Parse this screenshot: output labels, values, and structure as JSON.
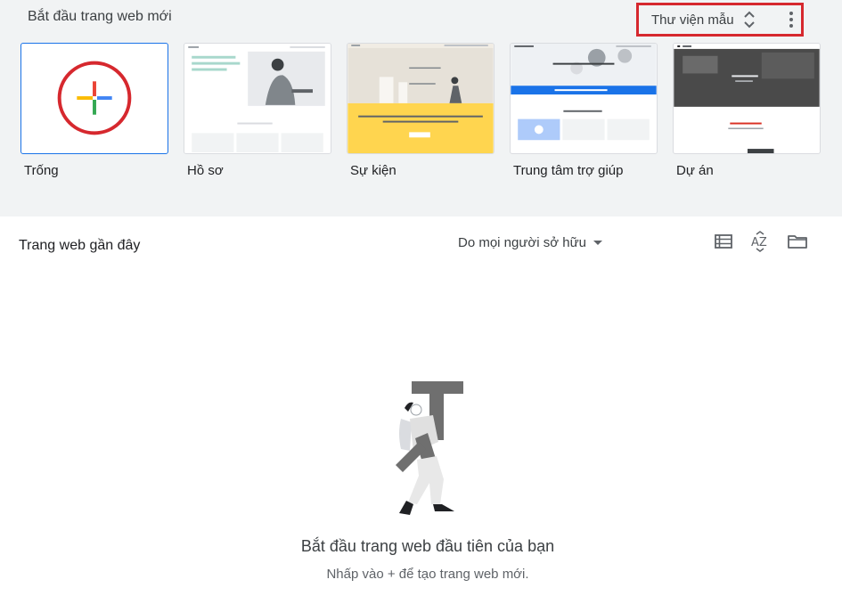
{
  "header": {
    "title": "Bắt đầu trang web mới",
    "gallery_label": "Thư viện mẫu"
  },
  "templates": [
    {
      "name": "Trống",
      "thumb_icon": "plus-icon"
    },
    {
      "name": "Hồ sơ",
      "thumb_text": "Xin chào, tôi là [Tên], một [Vai trò] ở [Địa điểm]"
    },
    {
      "name": "Sự kiện",
      "thumb_text": "[Tên sự kiện]"
    },
    {
      "name": "Trung tâm trợ giúp"
    },
    {
      "name": "Dự án"
    }
  ],
  "recent": {
    "title": "Trang web gần đây",
    "owner_filter": "Do mọi người sở hữu"
  },
  "empty_state": {
    "title": "Bắt đầu trang web đầu tiên của bạn",
    "subtitle": "Nhấp vào + để tạo trang web mới."
  },
  "colors": {
    "top_bg": "#f1f3f4",
    "highlight_red": "#d6282e",
    "google_blue": "#4285f4",
    "google_red": "#ea4335",
    "google_yellow": "#fbbc04",
    "google_green": "#34a853",
    "event_yellow": "#ffd54f",
    "help_blue": "#1a73e8"
  }
}
